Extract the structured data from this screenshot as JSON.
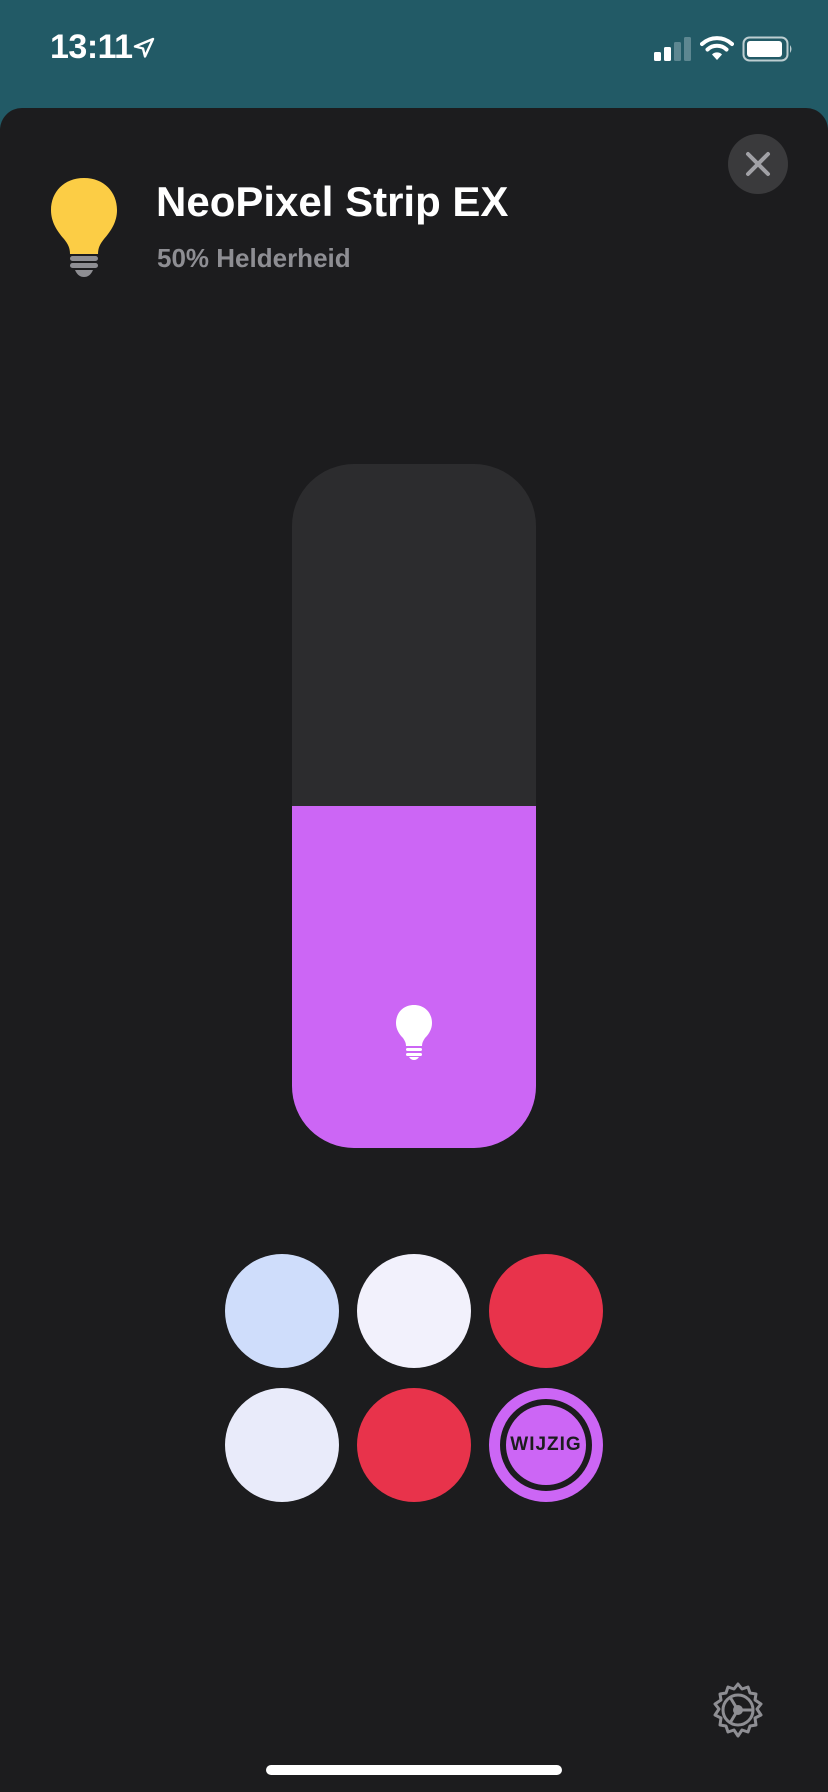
{
  "status_bar": {
    "time": "13:11",
    "location_icon": "location-arrow-icon",
    "signal_icon": "cellular-signal-icon",
    "wifi_icon": "wifi-icon",
    "battery_icon": "battery-icon"
  },
  "accessory": {
    "name": "NeoPixel Strip EX",
    "status": "50% Helderheid",
    "icon": "lightbulb-icon",
    "icon_color": "#fccd45"
  },
  "brightness": {
    "level_percent": 50,
    "fill_color": "#cc66f5",
    "icon": "lightbulb-icon"
  },
  "colors": {
    "swatches": [
      {
        "color": "#cfddfb"
      },
      {
        "color": "#f2f1fc"
      },
      {
        "color": "#e8334b"
      },
      {
        "color": "#e9ebfa"
      },
      {
        "color": "#e8334b"
      }
    ],
    "edit_label": "WIJZIG",
    "edit_color": "#cc66f5"
  },
  "controls": {
    "close_icon": "close-icon",
    "settings_icon": "gear-icon"
  }
}
